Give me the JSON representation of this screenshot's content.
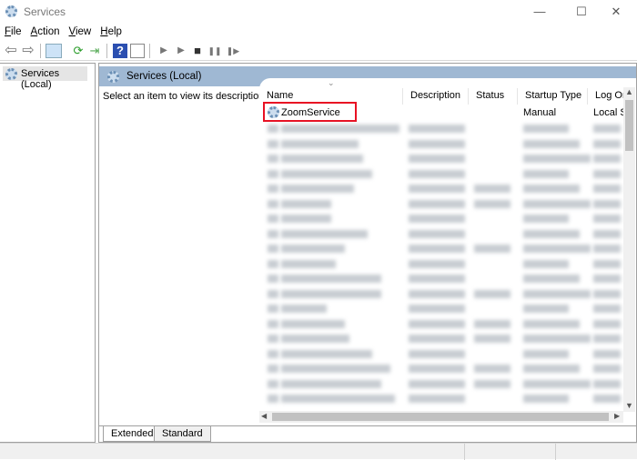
{
  "window": {
    "title": "Services",
    "minimize": "—",
    "maximize": "☐",
    "close": "✕"
  },
  "menu": [
    "File",
    "Action",
    "View",
    "Help"
  ],
  "toolbar": {
    "back": "⇦",
    "forward": "⇨",
    "play": "▶",
    "play2": "▶",
    "stop": "■",
    "pause": "❚❚",
    "resume": "❚▶",
    "help": "?"
  },
  "tree": {
    "item": "Services (Local)"
  },
  "panel": {
    "title": "Services (Local)",
    "description": "Select an item to view its description."
  },
  "columns": [
    "Name",
    "Description",
    "Status",
    "Startup Type",
    "Log On As"
  ],
  "columns_visible": [
    "Name",
    "Description",
    "Status",
    "Startup Type",
    "Log Or"
  ],
  "highlighted_row": {
    "name": "ZoomService",
    "description": "",
    "status": "",
    "startup": "Manual",
    "logon": "Local S"
  },
  "highlight_color": "#e81123",
  "tabs": [
    "Extended",
    "Standard"
  ]
}
